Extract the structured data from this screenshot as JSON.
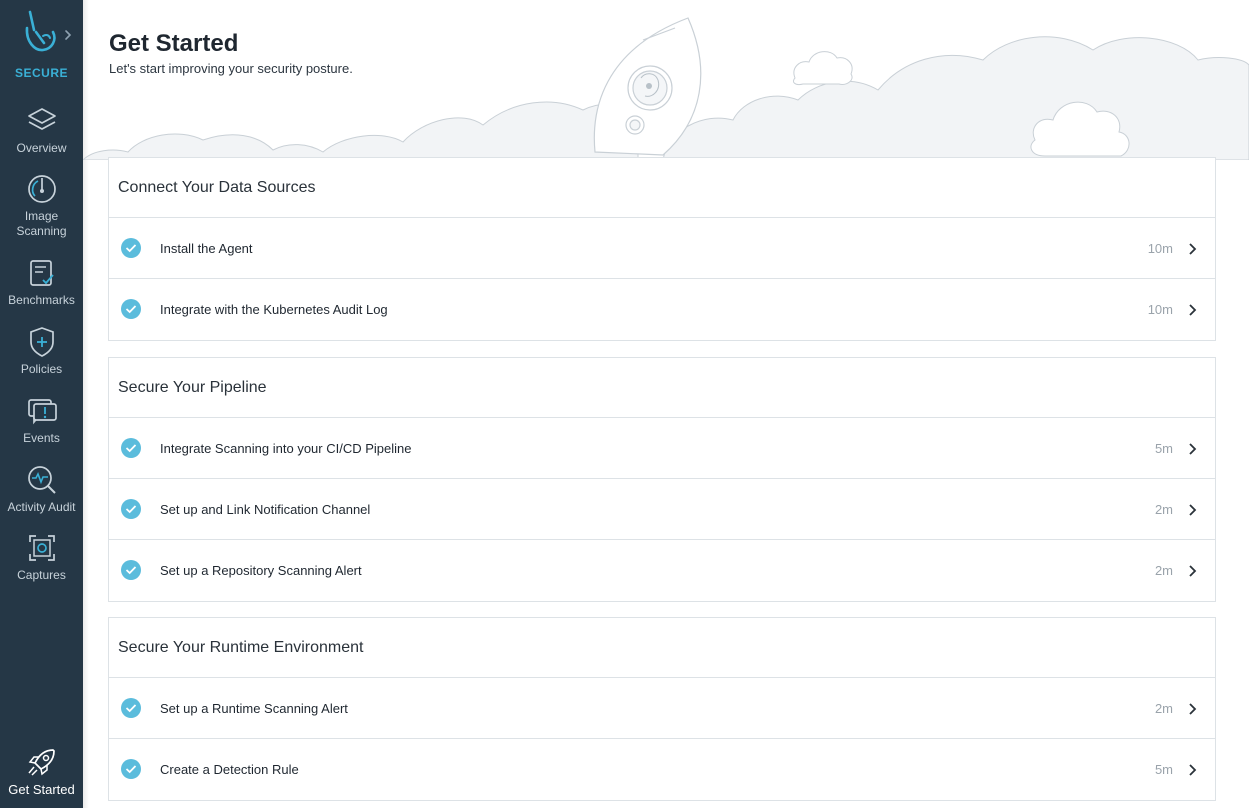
{
  "sidebar": {
    "brand": {
      "label": "SECURE"
    },
    "items": [
      {
        "label": "Overview",
        "icon": "layers-icon"
      },
      {
        "label": "Image\nScanning",
        "icon": "scan-icon"
      },
      {
        "label": "Benchmarks",
        "icon": "clipboard-check-icon"
      },
      {
        "label": "Policies",
        "icon": "shield-plus-icon"
      },
      {
        "label": "Events",
        "icon": "message-alert-icon"
      },
      {
        "label": "Activity Audit",
        "icon": "magnifier-pulse-icon"
      },
      {
        "label": "Captures",
        "icon": "capture-frame-icon"
      }
    ],
    "bottom": {
      "label": "Get Started",
      "icon": "rocket-icon"
    }
  },
  "header": {
    "title": "Get Started",
    "subtitle": "Let's start improving your security posture."
  },
  "sections": [
    {
      "title": "Connect Your Data Sources",
      "items": [
        {
          "label": "Install the Agent",
          "time": "10m"
        },
        {
          "label": "Integrate with the Kubernetes Audit Log",
          "time": "10m"
        }
      ]
    },
    {
      "title": "Secure Your Pipeline",
      "items": [
        {
          "label": "Integrate Scanning into your CI/CD Pipeline",
          "time": "5m"
        },
        {
          "label": "Set up and Link Notification Channel",
          "time": "2m"
        },
        {
          "label": "Set up a Repository Scanning Alert",
          "time": "2m"
        }
      ]
    },
    {
      "title": "Secure Your Runtime Environment",
      "items": [
        {
          "label": "Set up a Runtime Scanning Alert",
          "time": "2m"
        },
        {
          "label": "Create a Detection Rule",
          "time": "5m"
        }
      ]
    }
  ],
  "colors": {
    "sidebar_bg": "#253746",
    "accent": "#3ab0d6",
    "check": "#5bbcdc",
    "border": "#dde2e6"
  }
}
